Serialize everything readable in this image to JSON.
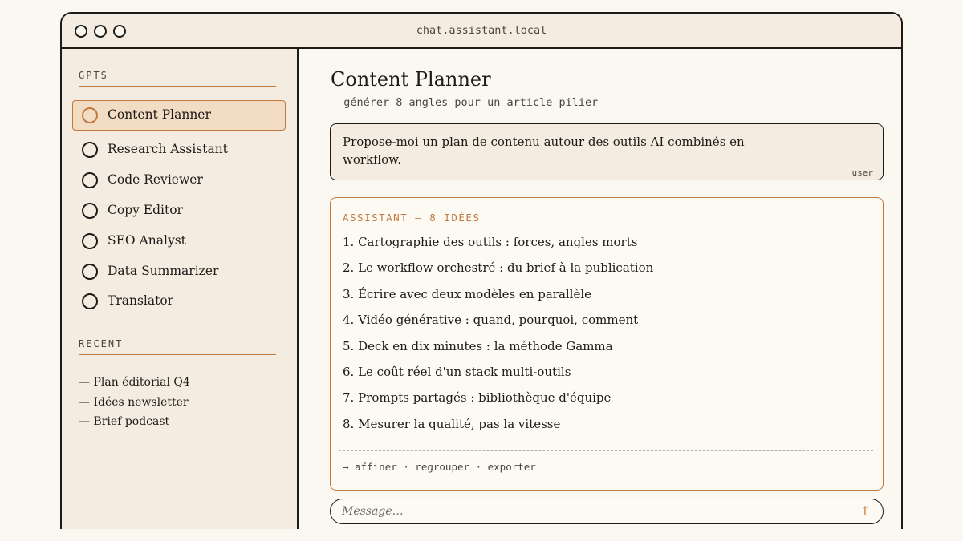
{
  "window": {
    "url": "chat.assistant.local"
  },
  "sidebar": {
    "gpts_heading": "GPTS",
    "gpts": [
      {
        "label": "Content Planner",
        "active": true
      },
      {
        "label": "Research Assistant"
      },
      {
        "label": "Code Reviewer"
      },
      {
        "label": "Copy Editor"
      },
      {
        "label": "SEO Analyst"
      },
      {
        "label": "Data Summarizer"
      },
      {
        "label": "Translator"
      }
    ],
    "recent_heading": "RECENT",
    "recent": [
      "— Plan éditorial Q4",
      "— Idées newsletter",
      "— Brief podcast"
    ]
  },
  "main": {
    "title": "Content Planner",
    "subtitle": "— générer 8 angles pour un article pilier",
    "user_message": {
      "text": "Propose-moi un plan de contenu autour des outils AI combinés en workflow.",
      "tag": "user"
    },
    "assistant": {
      "heading": "ASSISTANT — 8 IDÉES",
      "ideas": [
        "1. Cartographie des outils : forces, angles morts",
        "2. Le workflow orchestré : du brief à la publication",
        "3. Écrire avec deux modèles en parallèle",
        "4. Vidéo générative : quand, pourquoi, comment",
        "5. Deck en dix minutes : la méthode Gamma",
        "6. Le coût réel d'un stack multi-outils",
        "7. Prompts partagés : bibliothèque d'équipe",
        "8. Mesurer la qualité, pas la vitesse"
      ],
      "actions": "→ affiner · regrouper · exporter"
    },
    "composer": {
      "placeholder": "Message…",
      "send_icon": "arrow-up-icon"
    }
  },
  "colors": {
    "accent": "#c07a3f",
    "ink": "#1d1b18",
    "panel": "#f4ece0",
    "active_bg": "#f2dcc4"
  }
}
